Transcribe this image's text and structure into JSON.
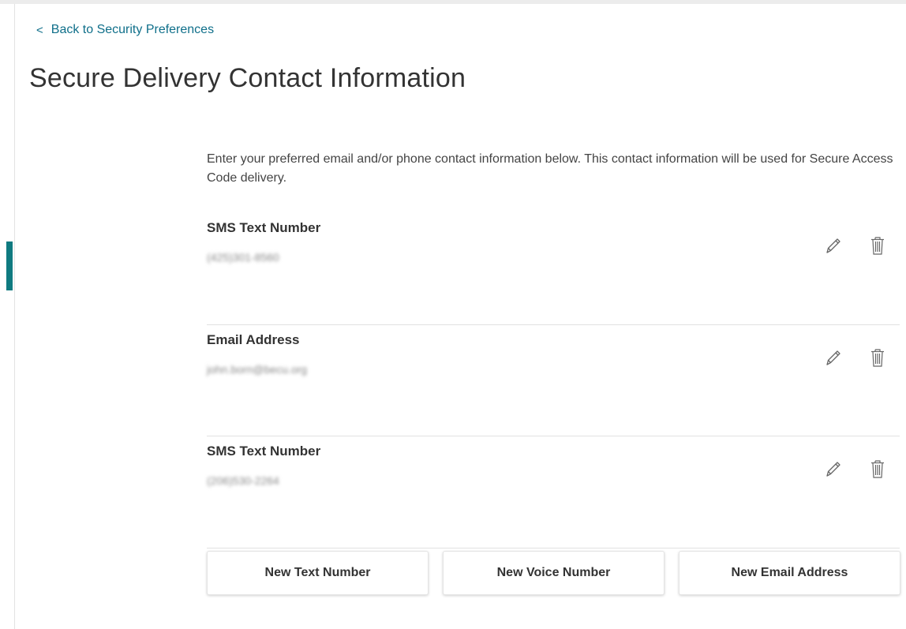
{
  "nav": {
    "back_chevron": "<",
    "back_label": "Back to Security Preferences"
  },
  "page": {
    "title": "Secure Delivery Contact Information",
    "intro": "Enter your preferred email and/or phone contact information below. This contact information will be used for Secure Access Code delivery."
  },
  "contacts": [
    {
      "label": "SMS Text Number",
      "value": "(425)301-8560",
      "edit_icon": "pencil-icon",
      "delete_icon": "trash-icon"
    },
    {
      "label": "Email Address",
      "value": "john.born@becu.org",
      "edit_icon": "pencil-icon",
      "delete_icon": "trash-icon"
    },
    {
      "label": "SMS Text Number",
      "value": "(206)530-2264",
      "edit_icon": "pencil-icon",
      "delete_icon": "trash-icon"
    }
  ],
  "actions": {
    "new_text": "New Text Number",
    "new_voice": "New Voice Number",
    "new_email": "New Email Address"
  },
  "colors": {
    "accent": "#0f7a80",
    "link": "#0f6f8a",
    "icon": "#666666"
  }
}
